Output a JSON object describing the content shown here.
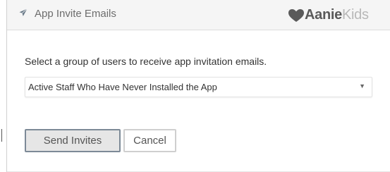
{
  "header": {
    "title": "App Invite Emails",
    "icon": "send-icon",
    "logo": {
      "strong": "Aanie",
      "light": "Kids"
    }
  },
  "body": {
    "instruction": "Select a group of users to receive app invitation emails.",
    "group_select": {
      "selected": "Active Staff Who Have Never Installed the App"
    }
  },
  "buttons": {
    "send_label": "Send Invites",
    "cancel_label": "Cancel"
  },
  "colors": {
    "header_bg": "#f5f5f5",
    "header_text": "#6d6d6d",
    "send_border": "#7d8a97",
    "send_bg": "#e6e6e6"
  }
}
